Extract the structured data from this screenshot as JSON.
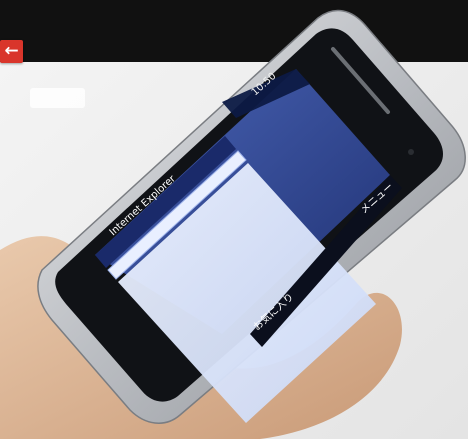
{
  "status_bar": {
    "time": "10:50"
  },
  "browser": {
    "app_title": "Internet Explorer"
  },
  "softkeys": {
    "left": "お気に入り",
    "right": "メニュー"
  },
  "colors": {
    "back_button": "#d9352b",
    "screen_bg": "#2a3f8a",
    "device_silver": "#c9ccd0"
  }
}
